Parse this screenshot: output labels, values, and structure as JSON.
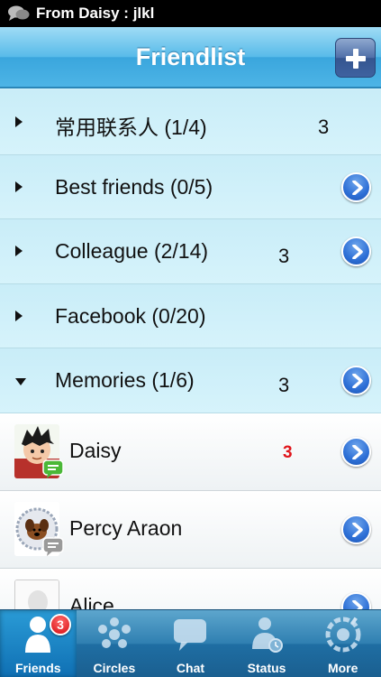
{
  "status_bar": {
    "icon": "speech-bubbles-icon",
    "text": "From Daisy : jlkl"
  },
  "nav": {
    "title": "Friendlist",
    "add_icon": "plus-icon"
  },
  "groups": [
    {
      "name": "常用联系人 (1/4)",
      "count": "3",
      "expanded": false,
      "has_disclosure": false
    },
    {
      "name": "Best friends (0/5)",
      "count": "",
      "expanded": false,
      "has_disclosure": true
    },
    {
      "name": "Colleague (2/14)",
      "count": "3",
      "expanded": false,
      "has_disclosure": true
    },
    {
      "name": "Facebook (0/20)",
      "count": "",
      "expanded": false,
      "has_disclosure": false
    },
    {
      "name": "Memories (1/6)",
      "count": "3",
      "expanded": true,
      "has_disclosure": true
    }
  ],
  "friends": [
    {
      "name": "Daisy",
      "unread": "3",
      "avatar": "cartoon-boy-avatar"
    },
    {
      "name": "Percy Araon",
      "unread": "",
      "avatar": "dog-avatar"
    },
    {
      "name": "Alice",
      "unread": "",
      "avatar": "default-avatar"
    }
  ],
  "tabs": [
    {
      "label": "Friends",
      "icon": "person-icon",
      "active": true,
      "badge": "3"
    },
    {
      "label": "Circles",
      "icon": "circles-icon",
      "active": false,
      "badge": ""
    },
    {
      "label": "Chat",
      "icon": "chat-bubble-icon",
      "active": false,
      "badge": ""
    },
    {
      "label": "Status",
      "icon": "status-icon",
      "active": false,
      "badge": ""
    },
    {
      "label": "More",
      "icon": "more-icon",
      "active": false,
      "badge": ""
    }
  ],
  "colors": {
    "accent": "#3aa6dd",
    "unread": "#e0151b",
    "tabbar": "#1f6ea3"
  }
}
